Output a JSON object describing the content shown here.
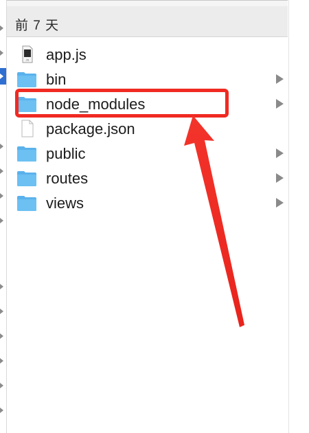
{
  "column": {
    "header": "前 7 天",
    "items": [
      {
        "name": "app.js",
        "icon": "js-file-icon",
        "expandable": false
      },
      {
        "name": "bin",
        "icon": "folder-icon",
        "expandable": true
      },
      {
        "name": "node_modules",
        "icon": "folder-icon",
        "expandable": true
      },
      {
        "name": "package.json",
        "icon": "document-icon",
        "expandable": false
      },
      {
        "name": "public",
        "icon": "folder-icon",
        "expandable": true
      },
      {
        "name": "routes",
        "icon": "folder-icon",
        "expandable": true
      },
      {
        "name": "views",
        "icon": "folder-icon",
        "expandable": true
      }
    ]
  },
  "annotation": {
    "highlighted_item": "node_modules",
    "color": "#f02a22"
  },
  "colors": {
    "folder": "#5ab2ec",
    "selection": "#2f6fd1",
    "header_bg": "#ececec"
  }
}
